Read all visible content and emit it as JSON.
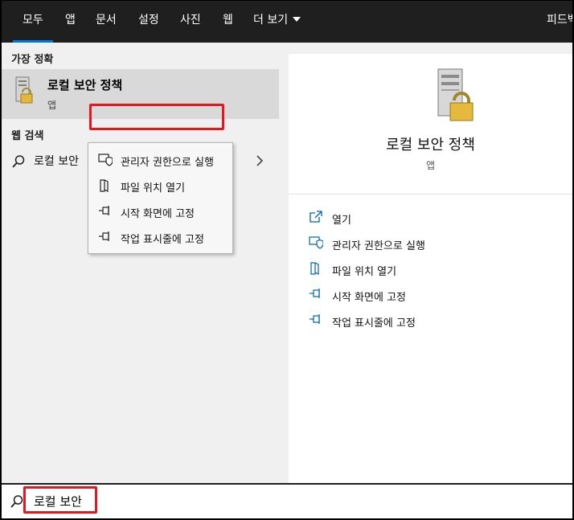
{
  "tabs": [
    {
      "label": "모두",
      "active": true
    },
    {
      "label": "앱"
    },
    {
      "label": "문서"
    },
    {
      "label": "설정"
    },
    {
      "label": "사진"
    },
    {
      "label": "웹"
    },
    {
      "label": "더 보기"
    }
  ],
  "feedback_label": "피드백",
  "best_match": {
    "heading": "가장 정확",
    "title": "로컬 보안 정책",
    "subtitle": "앱",
    "icon": "server-lock-icon"
  },
  "web_search": {
    "heading": "웹 검색",
    "query_label": "로컬 보안"
  },
  "context_menu": [
    {
      "label": "관리자 권한으로 실행",
      "icon": "admin-shield-icon"
    },
    {
      "label": "파일 위치 열기",
      "icon": "file-location-icon"
    },
    {
      "label": "시작 화면에 고정",
      "icon": "pin-icon"
    },
    {
      "label": "작업 표시줄에 고정",
      "icon": "pin-icon"
    }
  ],
  "details": {
    "title": "로컬 보안 정책",
    "subtitle": "앱",
    "actions": [
      {
        "label": "열기",
        "icon": "open-icon"
      },
      {
        "label": "관리자 권한으로 실행",
        "icon": "admin-shield-icon"
      },
      {
        "label": "파일 위치 열기",
        "icon": "file-location-icon"
      },
      {
        "label": "시작 화면에 고정",
        "icon": "pin-icon"
      },
      {
        "label": "작업 표시줄에 고정",
        "icon": "pin-icon"
      }
    ]
  },
  "search": {
    "value": "로컬 보안"
  },
  "colors": {
    "accent": "#0078d7",
    "highlight_box": "#e8141e",
    "topbar": "#1f1f1f"
  }
}
